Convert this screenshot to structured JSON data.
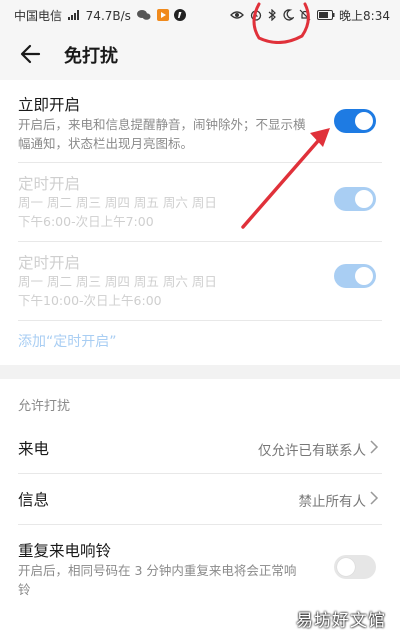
{
  "status_bar": {
    "carrier": "中国电信",
    "network_speed": "74.7B/s",
    "time": "晚上8:34"
  },
  "header": {
    "title": "免打扰"
  },
  "settings": {
    "immediate": {
      "title": "立即开启",
      "description": "开启后，来电和信息提醒静音，闹钟除外；不显示横幅通知，状态栏出现月亮图标。",
      "enabled": true
    },
    "schedule1": {
      "title": "定时开启",
      "days": "周一 周二 周三 周四 周五 周六 周日",
      "time": "下午6:00-次日上午7:00",
      "enabled": true
    },
    "schedule2": {
      "title": "定时开启",
      "days": "周一 周二 周三 周四 周五 周六 周日",
      "time": "下午10:00-次日上午6:00",
      "enabled": true
    },
    "add_schedule": "添加“定时开启”"
  },
  "allow_section": {
    "header": "允许打扰",
    "calls": {
      "label": "来电",
      "value": "仅允许已有联系人"
    },
    "messages": {
      "label": "信息",
      "value": "禁止所有人"
    },
    "repeat_calls": {
      "label": "重复来电响铃",
      "description": "开启后，相同号码在 3 分钟内重复来电将会正常响铃",
      "enabled": false
    }
  },
  "watermark": "易坊好文馆",
  "colors": {
    "accent": "#1e7be3",
    "accent_disabled": "#a9cef3",
    "annotation": "#e0313a"
  },
  "icons": [
    "back-arrow-icon",
    "chevron-right-icon",
    "moon-icon",
    "bell-off-icon",
    "alarm-icon",
    "eye-icon",
    "battery-icon",
    "signal-icon",
    "wechat-icon"
  ]
}
